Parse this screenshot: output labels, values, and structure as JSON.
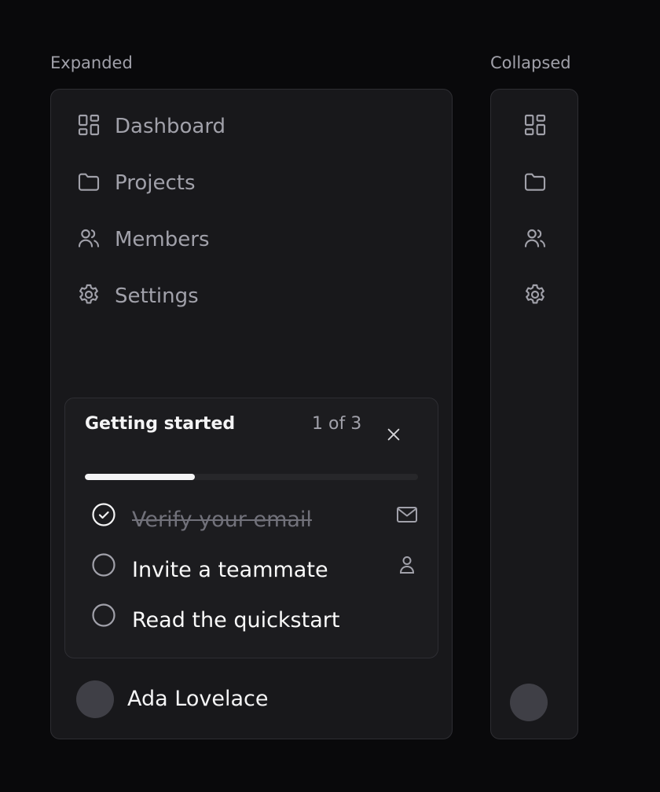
{
  "captions": {
    "expanded": "Expanded",
    "collapsed": "Collapsed"
  },
  "nav": [
    {
      "label": "Dashboard",
      "icon": "dashboard-icon"
    },
    {
      "label": "Projects",
      "icon": "folder-icon"
    },
    {
      "label": "Members",
      "icon": "users-icon"
    },
    {
      "label": "Settings",
      "icon": "gear-icon"
    }
  ],
  "onboarding": {
    "title": "Getting started",
    "progress_text": "1 of 3",
    "progress_fraction": 0.33,
    "tasks": [
      {
        "label": "Verify your email",
        "done": true,
        "icon": "mail-icon"
      },
      {
        "label": "Invite a teammate",
        "done": false,
        "icon": "user-icon"
      },
      {
        "label": "Read the quickstart",
        "done": false,
        "icon": ""
      }
    ]
  },
  "user": {
    "name": "Ada Lovelace"
  },
  "colors": {
    "background": "#09090b",
    "panel": "#18181b",
    "card": "#1c1c1f",
    "border": "#2e2e33",
    "text_muted": "#a1a1aa",
    "text_strong": "#f4f4f5",
    "progress_fill": "#f4f4f5",
    "avatar": "#3f3f46"
  }
}
